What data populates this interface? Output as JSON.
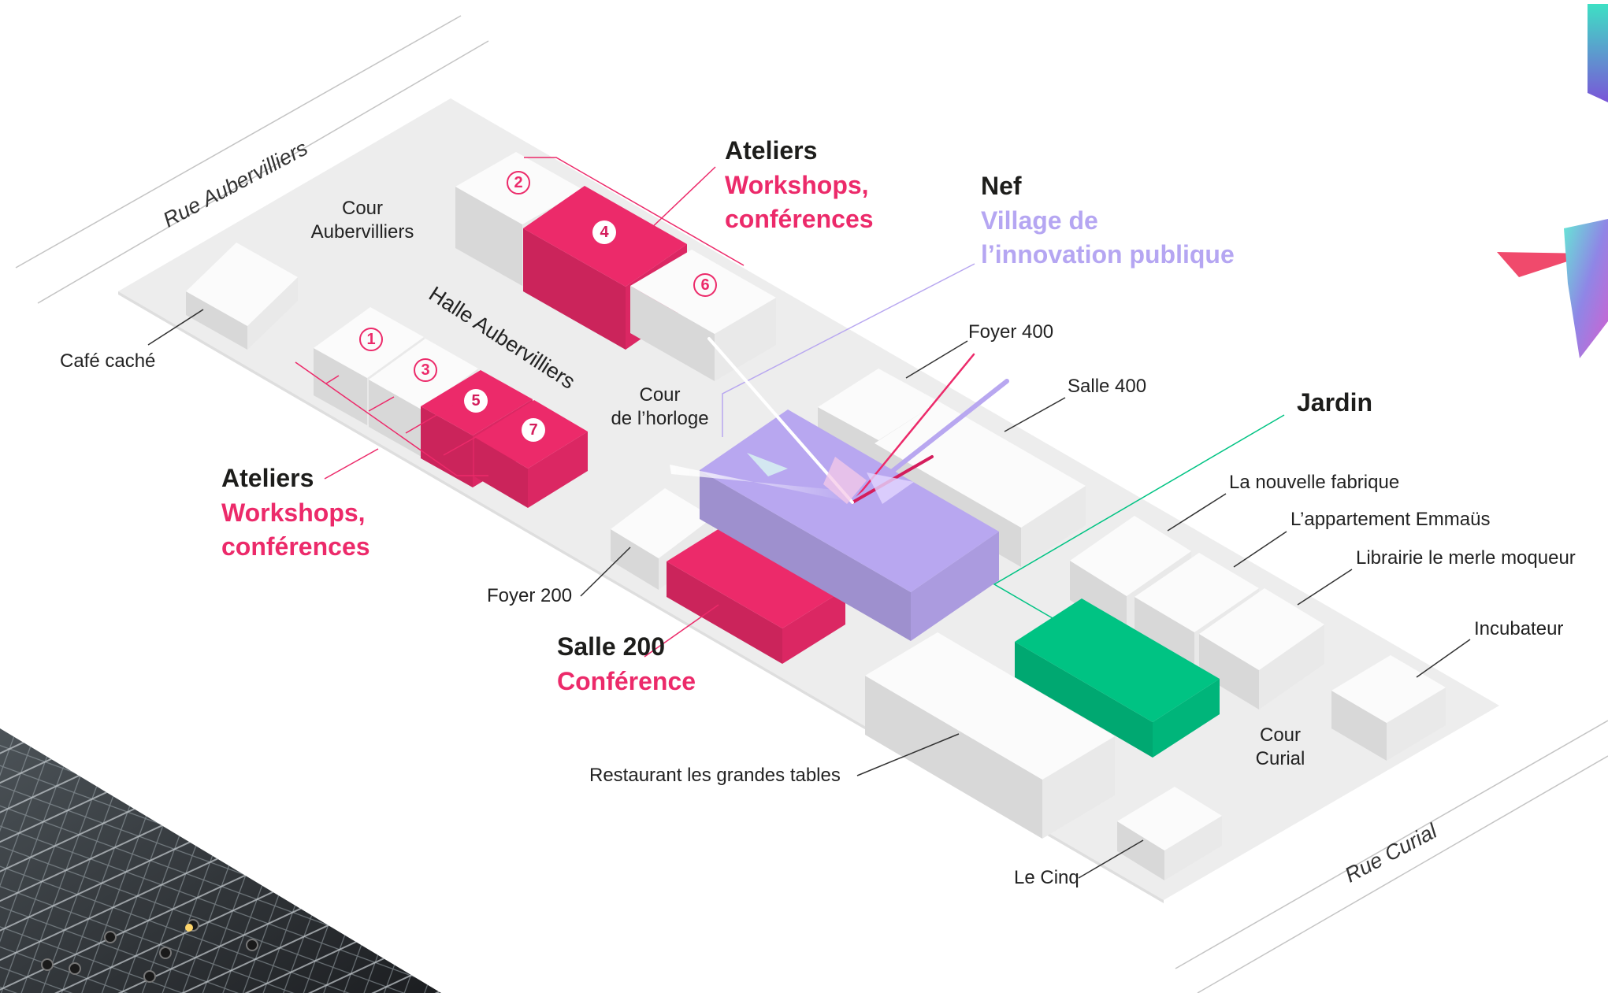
{
  "streets": {
    "north": "Rue Aubervilliers",
    "south": "Rue Curial"
  },
  "areas": {
    "cour_aubervilliers": [
      "Cour",
      "Aubervilliers"
    ],
    "halle_aubervilliers": "Halle Aubervilliers",
    "cour_horloge": [
      "Cour",
      "de l’horloge"
    ],
    "cour_curial": [
      "Cour",
      "Curial"
    ]
  },
  "venues": {
    "cafe_cache": "Café caché",
    "foyer_200": "Foyer 200",
    "foyer_400": "Foyer 400",
    "salle_400": "Salle 400",
    "la_nouvelle_fabrique": "La nouvelle fabrique",
    "appartement_emmaus": "L’appartement Emmaüs",
    "librairie": "Librairie le merle moqueur",
    "incubateur": "Incubateur",
    "restaurant": "Restaurant les grandes tables",
    "le_cinq": "Le Cinq"
  },
  "highlights": {
    "ateliers_top": {
      "title": "Ateliers",
      "subtitle": [
        "Workshops,",
        "conférences"
      ]
    },
    "ateliers_left": {
      "title": "Ateliers",
      "subtitle": [
        "Workshops,",
        "conférences"
      ]
    },
    "nef": {
      "title": "Nef",
      "subtitle": [
        "Village de",
        "l’innovation publique"
      ]
    },
    "jardin": {
      "title": "Jardin"
    },
    "salle_200": {
      "title": "Salle 200",
      "subtitle": "Conférence"
    }
  },
  "room_numbers": [
    "1",
    "2",
    "3",
    "4",
    "5",
    "6",
    "7"
  ],
  "colors": {
    "atelier_pink": "#ec2a6a",
    "nef_lilac": "#b8a7f0",
    "jardin_green": "#00c383",
    "building_white": "#fbfbfb",
    "ground_gray": "#ececec"
  }
}
